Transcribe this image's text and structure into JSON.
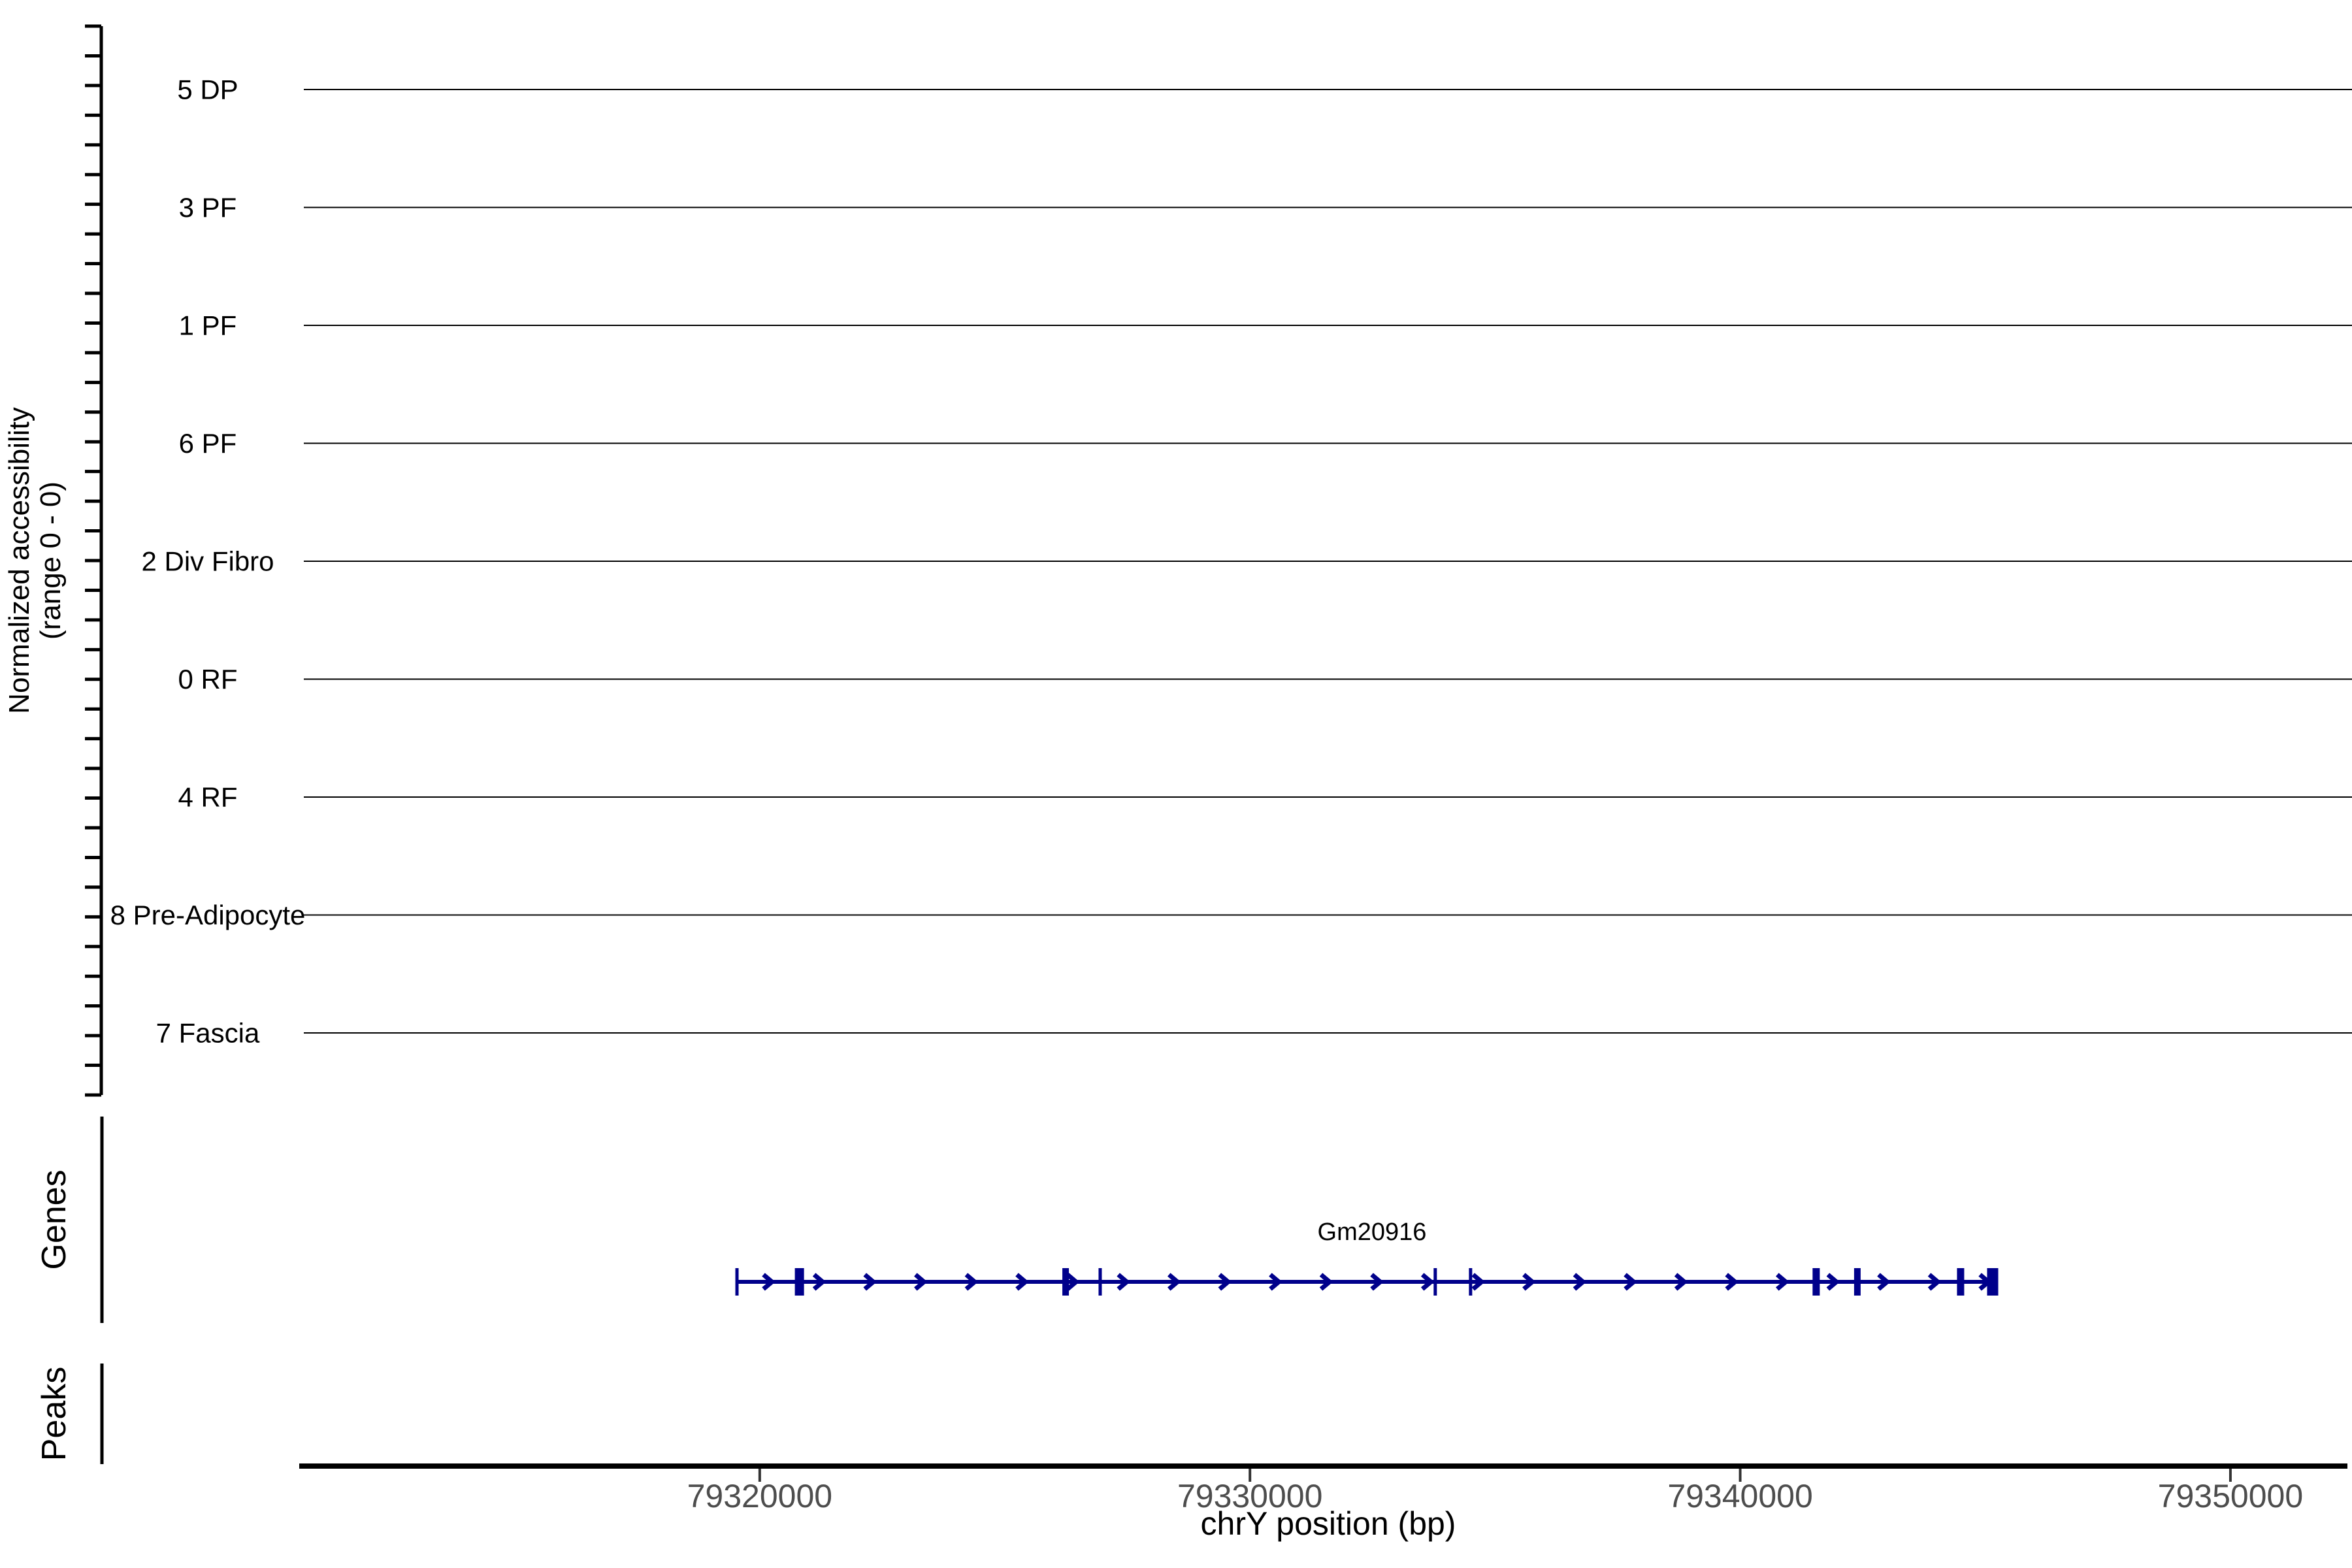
{
  "figure": {
    "y_axis_title_line1": "Normalized accessibility",
    "y_axis_title_line2": "(range 0 - 0)",
    "genes_label": "Genes",
    "peaks_label": "Peaks",
    "x_axis_title": "chrY position (bp)",
    "colors": {
      "background": "#ffffff",
      "axis": "#000000",
      "gridline": "#000000",
      "tick_label": "#4d4d4d",
      "track_label": "#000000",
      "gene": "#00008B"
    }
  },
  "chart_data": {
    "type": "area",
    "subtype": "genome-coverage-tracks",
    "title": "",
    "xlabel": "chrY position (bp)",
    "ylabel": "Normalized accessibility (range 0 - 0)",
    "xlim": [
      79310700,
      79352480
    ],
    "x_ticks": [
      79320000,
      79330000,
      79340000,
      79350000
    ],
    "x_tick_labels": [
      "79320000",
      "79330000",
      "79340000",
      "79350000"
    ],
    "grid": false,
    "legend_position": "none",
    "series": [
      {
        "name": "5 DP",
        "range": [
          0,
          0
        ],
        "values": []
      },
      {
        "name": "3 PF",
        "range": [
          0,
          0
        ],
        "values": []
      },
      {
        "name": "1 PF",
        "range": [
          0,
          0
        ],
        "values": []
      },
      {
        "name": "6 PF",
        "range": [
          0,
          0
        ],
        "values": []
      },
      {
        "name": "2 Div Fibro",
        "range": [
          0,
          0
        ],
        "values": []
      },
      {
        "name": "0 RF",
        "range": [
          0,
          0
        ],
        "values": []
      },
      {
        "name": "4 RF",
        "range": [
          0,
          0
        ],
        "values": []
      },
      {
        "name": "8 Pre-Adipocyte",
        "range": [
          0,
          0
        ],
        "values": []
      },
      {
        "name": "7 Fascia",
        "range": [
          0,
          0
        ],
        "values": []
      }
    ],
    "gene_annotations": [
      {
        "name": "Gm20916",
        "chrom": "chrY",
        "strand": "+",
        "start": 79319536,
        "end": 79345260,
        "strand_arrow_spacing_bp": 1034,
        "exons": [
          {
            "pos": 79319536,
            "w": 5
          },
          {
            "pos": 79320810,
            "w": 14
          },
          {
            "pos": 79326240,
            "w": 10
          },
          {
            "pos": 79326945,
            "w": 5
          },
          {
            "pos": 79333780,
            "w": 5
          },
          {
            "pos": 79334500,
            "w": 5
          },
          {
            "pos": 79341550,
            "w": 11
          },
          {
            "pos": 79342390,
            "w": 10
          },
          {
            "pos": 79344496,
            "w": 11
          },
          {
            "pos": 79345150,
            "w": 17
          }
        ]
      }
    ],
    "peaks": []
  }
}
